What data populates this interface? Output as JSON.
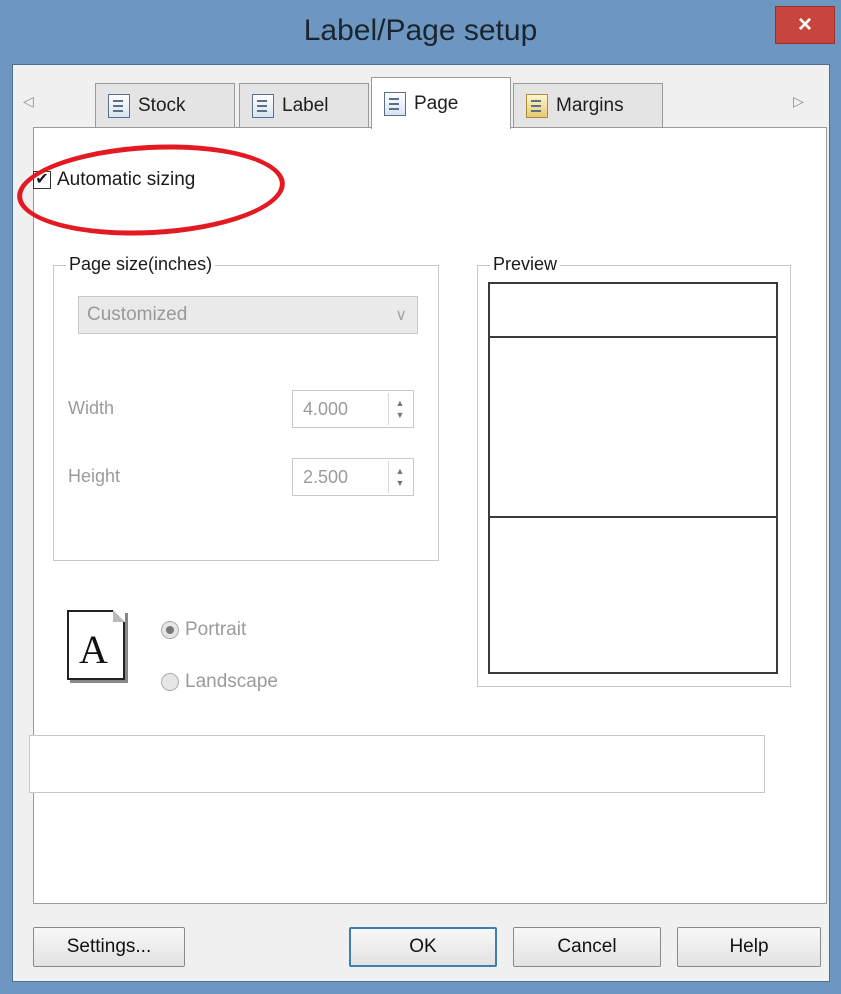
{
  "window": {
    "title": "Label/Page setup",
    "close_label": "×"
  },
  "tabs": [
    {
      "label": "Stock",
      "icon": "stock-icon"
    },
    {
      "label": "Label",
      "icon": "label-icon"
    },
    {
      "label": "Page",
      "icon": "page-icon",
      "active": true
    },
    {
      "label": "Margins",
      "icon": "margins-icon"
    }
  ],
  "tab_scroll": {
    "left": "◁",
    "right": "▷"
  },
  "auto_sizing": {
    "label": "Automatic sizing",
    "checked": true,
    "check_glyph": "✔",
    "highlight_color": "#e41a22"
  },
  "page_size": {
    "legend": "Page size(inches)",
    "preset_value": "Customized",
    "dropdown_glyph": "∨",
    "width_label": "Width",
    "width_value": "4.000",
    "height_label": "Height",
    "height_value": "2.500",
    "spin_up": "▲",
    "spin_down": "▼"
  },
  "preview": {
    "legend": "Preview"
  },
  "orientation": {
    "icon_letter": "A",
    "portrait_label": "Portrait",
    "landscape_label": "Landscape",
    "selected": "Portrait"
  },
  "buttons": {
    "settings": "Settings...",
    "ok": "OK",
    "cancel": "Cancel",
    "help": "Help"
  },
  "colors": {
    "title_bar": "#6d97c1",
    "close_button": "#c7453d",
    "default_button_border": "#3c7fb1"
  }
}
